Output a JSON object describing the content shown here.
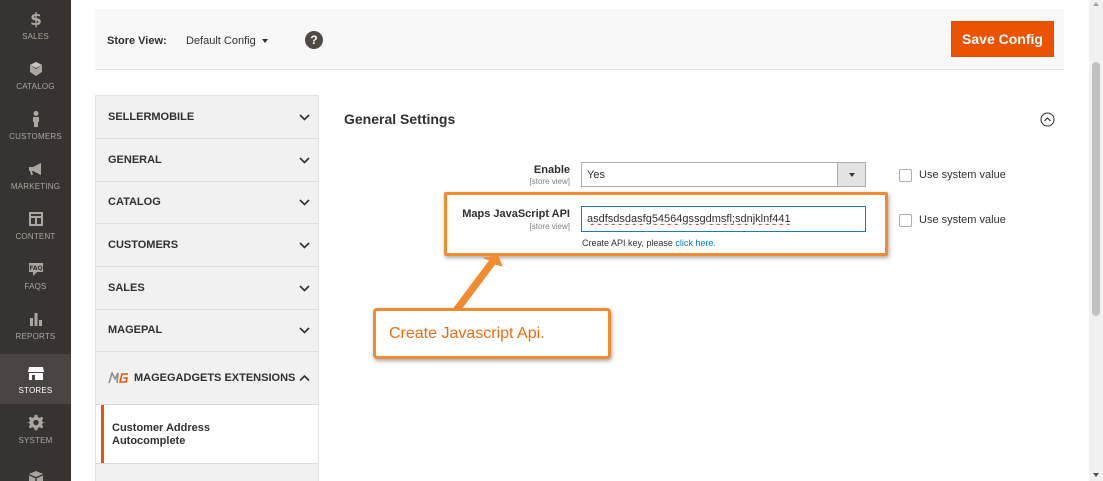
{
  "nav": {
    "items": [
      {
        "label": "SALES",
        "icon": "dollar-icon"
      },
      {
        "label": "CATALOG",
        "icon": "cube-icon"
      },
      {
        "label": "CUSTOMERS",
        "icon": "person-icon"
      },
      {
        "label": "MARKETING",
        "icon": "megaphone-icon"
      },
      {
        "label": "CONTENT",
        "icon": "layout-icon"
      },
      {
        "label": "FAQS",
        "icon": "faq-icon"
      },
      {
        "label": "REPORTS",
        "icon": "bar-chart-icon"
      },
      {
        "label": "STORES",
        "icon": "store-icon",
        "active": true
      },
      {
        "label": "SYSTEM",
        "icon": "gear-icon"
      },
      {
        "label": "",
        "icon": "box-icon"
      }
    ]
  },
  "header": {
    "store_view_label": "Store View:",
    "store_view_value": "Default Config",
    "help": "?",
    "save_label": "Save Config"
  },
  "tabs": {
    "items": [
      "SELLERMOBILE",
      "GENERAL",
      "CATALOG",
      "CUSTOMERS",
      "SALES",
      "MAGEPAL",
      "MAGEGADGETS EXTENSIONS"
    ],
    "sub_item": "Customer Address Autocomplete"
  },
  "section": {
    "title": "General Settings",
    "enable": {
      "label": "Enable",
      "scope": "[store view]",
      "value": "Yes",
      "use_system_value": "Use system value"
    },
    "api_key": {
      "label": "Maps JavaScript API",
      "scope": "[store view]",
      "value": "asdfsdsdasfg54564gssgdmsfl;sdnjklnf441",
      "note_prefix": "Create API key, please",
      "note_link": "click here.",
      "use_system_value": "Use system value"
    }
  },
  "annotation": {
    "callout_text": "Create Javascript Api.",
    "color": "#f28a2e"
  },
  "colors": {
    "accent": "#eb5202",
    "nav_bg": "#373330",
    "link": "#007bdb"
  }
}
